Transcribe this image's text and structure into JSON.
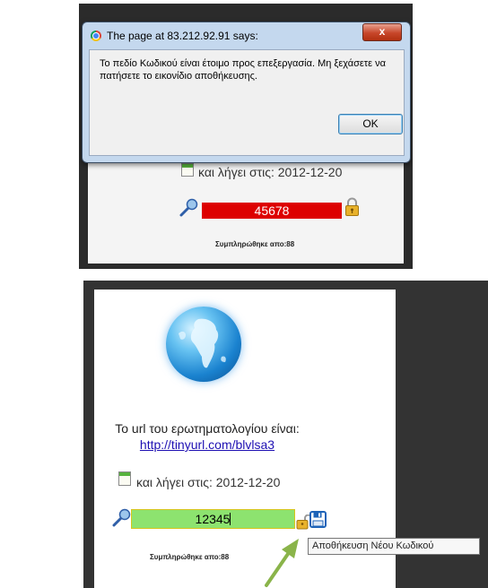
{
  "top_screenshot": {
    "dialog": {
      "title": "The page at 83.212.92.91 says:",
      "close_label": "x",
      "message": "Το πεδίο Κωδικού είναι έτοιμο προς επεξεργασία. Μη ξεχάσετε να πατήσετε το εικονίδιο αποθήκευσης.",
      "ok_label": "OK"
    },
    "expire_text": "και λήγει στις: 2012-12-20",
    "code_value": "45678",
    "code_field_color": "#dd0000",
    "filled_text": "Συμπληρώθηκε απο:88"
  },
  "bottom_screenshot": {
    "survey_url_label": "Το url του ερωτηματολογίου είναι:",
    "survey_url": "http://tinyurl.com/blvlsa3",
    "expire_text": "και λήγει στις: 2012-12-20",
    "code_value": "12345",
    "code_field_color": "#8de36f",
    "filled_text": "Συμπληρώθηκε απο:88",
    "tooltip": "Αποθήκευση Νέου Κωδικού"
  },
  "icons": [
    "chrome-icon",
    "note-icon",
    "key-icon",
    "lock-icon",
    "unlock-icon",
    "floppy-icon",
    "globe-icon",
    "arrow-icon"
  ]
}
